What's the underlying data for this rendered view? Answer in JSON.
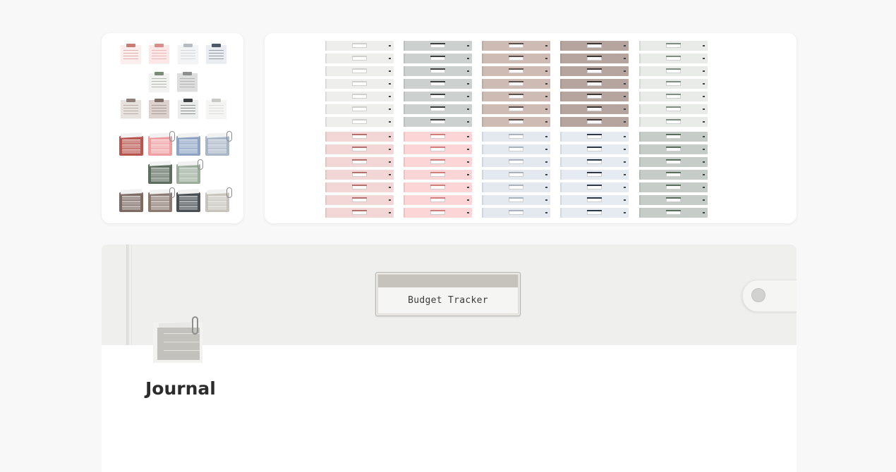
{
  "cover": {
    "label": "Budget Tracker"
  },
  "page": {
    "title": "Journal"
  },
  "icons": {
    "notes": [
      {
        "name": "red-note-icon",
        "accent": "#c57d76",
        "paper": "#fbeeed"
      },
      {
        "name": "pink-note-icon",
        "accent": "#d88f8c",
        "paper": "#fde7e7"
      },
      {
        "name": "grey-note-icon",
        "accent": "#b6bcc2",
        "paper": "#f3f4f6"
      },
      {
        "name": "navy-note-icon",
        "accent": "#4f5866",
        "paper": "#e9edf2"
      },
      {
        "name": "sage-note-icon",
        "accent": "#7d8a7a",
        "paper": "#f2f3f1"
      },
      {
        "name": "stone-note-icon",
        "accent": "#8d8f8e",
        "paper": "#dedede"
      },
      {
        "name": "beige-note-icon",
        "accent": "#8f7f79",
        "paper": "#e8e2df"
      },
      {
        "name": "taupe-note-icon",
        "accent": "#7f6e68",
        "paper": "#ddd2cd"
      },
      {
        "name": "charcoal-note-icon",
        "accent": "#3e4143",
        "paper": "#eceded"
      },
      {
        "name": "light-note-icon",
        "accent": "#c9c9c7",
        "paper": "#f5f5f4"
      }
    ],
    "binders": [
      {
        "name": "red-binder-icon",
        "color": "#b9554f"
      },
      {
        "name": "pink-binder-icon",
        "color": "#ee9ea0"
      },
      {
        "name": "blue-binder-icon",
        "color": "#8ea3c3"
      },
      {
        "name": "slate-binder-icon",
        "color": "#a8b6c7"
      },
      {
        "name": "green-binder-icon",
        "color": "#5e6e5e"
      },
      {
        "name": "mint-binder-icon",
        "color": "#9cad9c"
      },
      {
        "name": "brown-binder-icon",
        "color": "#7c6a63"
      },
      {
        "name": "mocha-binder-icon",
        "color": "#8c7a72"
      },
      {
        "name": "dark-binder-icon",
        "color": "#4a4f53"
      },
      {
        "name": "khaki-binder-icon",
        "color": "#c6c4bb"
      }
    ]
  },
  "tab_sets": [
    {
      "name": "light-grey-tabs",
      "color": "#eeeeed",
      "accent": "#cfcfcd"
    },
    {
      "name": "grey-tabs",
      "color": "#ccd0cf",
      "accent": "#3c3e3f"
    },
    {
      "name": "rose-taupe-tabs",
      "color": "#cebbb4",
      "accent": "#5b4f4b"
    },
    {
      "name": "brown-tabs",
      "color": "#b6a59e",
      "accent": "#3d3532"
    },
    {
      "name": "pale-sage-tabs",
      "color": "#e8ebe8",
      "accent": "#7f8c80"
    },
    {
      "name": "blush-tabs",
      "color": "#f3d7d7",
      "accent": "#b5706d"
    },
    {
      "name": "pink-tabs",
      "color": "#fcd6d6",
      "accent": "#d07f7d"
    },
    {
      "name": "ice-blue-tabs",
      "color": "#e3e9ef",
      "accent": "#aab3bd"
    },
    {
      "name": "powder-blue-tabs",
      "color": "#e6ebf1",
      "accent": "#2f3946"
    },
    {
      "name": "sage-tabs",
      "color": "#c6ccc8",
      "accent": "#5b6e5d"
    }
  ]
}
